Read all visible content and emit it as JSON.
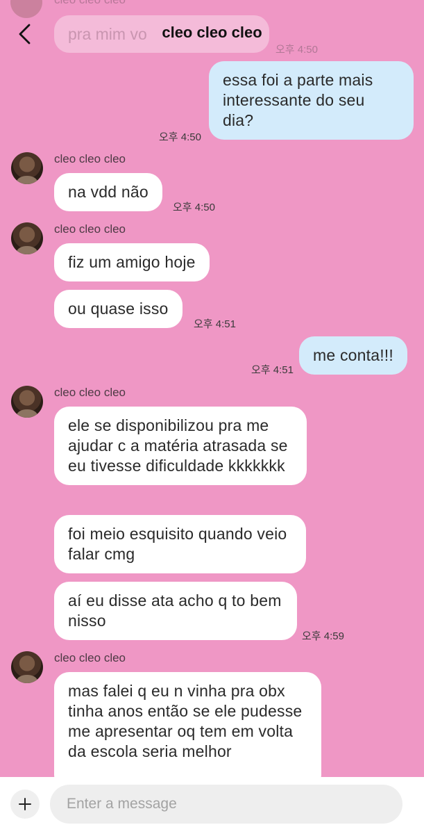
{
  "header": {
    "title": "cleo cleo cleo",
    "ghost": {
      "sender": "cleo cleo cleo",
      "text": "pra mim vo",
      "time": "오후 4:50"
    }
  },
  "messages": [
    {
      "dir": "out",
      "text": "essa foi a parte mais interessante do seu dia?",
      "time": "오후 4:50"
    },
    {
      "dir": "in",
      "sender": "cleo cleo cleo",
      "text": "na vdd não",
      "time": "오후 4:50"
    },
    {
      "dir": "in",
      "sender": "cleo cleo cleo",
      "text": "fiz um amigo hoje"
    },
    {
      "dir": "in",
      "text": "ou quase isso",
      "time": "오후 4:51"
    },
    {
      "dir": "out",
      "text": "me conta!!!",
      "time": "오후 4:51"
    },
    {
      "dir": "in",
      "sender": "cleo cleo cleo",
      "text": "ele se disponibilizou pra me ajudar c a matéria atrasada se eu tivesse dificuldade kkkkkkk"
    },
    {
      "dir": "in",
      "text": "foi meio esquisito quando veio falar cmg"
    },
    {
      "dir": "in",
      "text": "aí eu disse ata acho q to bem nisso",
      "time": "오후 4:59"
    },
    {
      "dir": "in",
      "sender": "cleo cleo cleo",
      "text": "mas falei q eu n vinha pra obx tinha anos então se ele pudesse me apresentar oq tem em volta da escola seria melhor"
    }
  ],
  "composer": {
    "placeholder": "Enter a message",
    "plus_icon": "plus-icon"
  },
  "colors": {
    "background": "#EF97C5",
    "incoming_bubble": "#FFFFFF",
    "outgoing_bubble": "#D3EBFB",
    "composer_bg": "#FFFFFF",
    "input_bg": "#EEEEEE"
  }
}
